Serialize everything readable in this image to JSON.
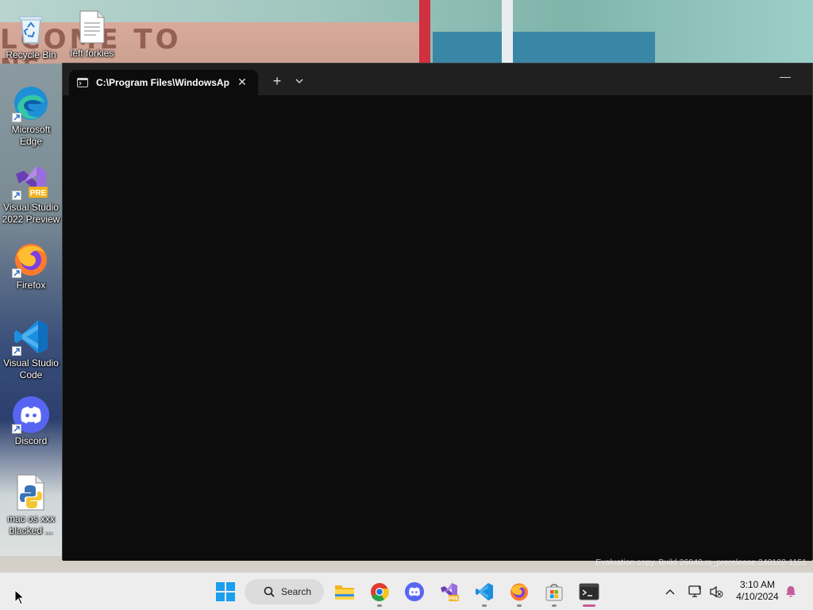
{
  "desktop": {
    "icons": [
      {
        "label": "Recycle Bin",
        "icon": "recycle-bin-icon"
      },
      {
        "label": "left forkies",
        "icon": "text-file-icon"
      },
      {
        "label": "Microsoft Edge",
        "icon": "edge-icon"
      },
      {
        "label": "Visual Studio 2022 Preview",
        "icon": "visual-studio-preview-icon"
      },
      {
        "label": "Firefox",
        "icon": "firefox-icon"
      },
      {
        "label": "Visual Studio Code",
        "icon": "vscode-icon"
      },
      {
        "label": "Discord",
        "icon": "discord-icon"
      },
      {
        "label": "mac os xxx blacked ...",
        "icon": "python-file-icon"
      }
    ],
    "wallpaper_text": [
      "LCOME TO",
      "NS"
    ]
  },
  "terminal": {
    "tab_title": "C:\\Program Files\\WindowsAp",
    "new_tab": "+",
    "close_tab": "✕",
    "minimize": "—",
    "background": "#0c0c0c"
  },
  "watermark": "Evaluation copy. Build 26040.rs_prerelease.240122-1151",
  "taskbar": {
    "search_label": "Search",
    "apps": [
      "start",
      "file-explorer",
      "chrome",
      "discord",
      "visual-studio-preview",
      "vscode",
      "firefox",
      "microsoft-store",
      "terminal"
    ],
    "clock_time": "3:10 AM",
    "clock_date": "4/10/2024",
    "accent_color": "#c55a9a"
  }
}
